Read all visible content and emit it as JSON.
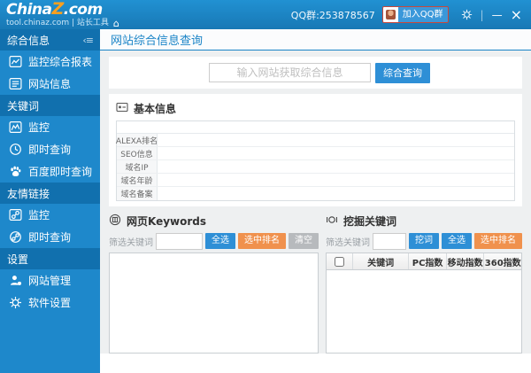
{
  "window": {
    "logo": {
      "china": "China",
      "z": "Z",
      "com": ".com"
    },
    "subtitle": "tool.chinaz.com | 站长工具",
    "home_icon": "⌂",
    "qq_group_label": "QQ群:253878567",
    "join_qq_label": "加入QQ群",
    "controls": {
      "separator": "|",
      "minimize": "—",
      "close": "×"
    }
  },
  "sidebar": {
    "collapse_icon": "‹≡",
    "sections": [
      {
        "label": "综合信息",
        "items": [
          {
            "label": "监控综合报表",
            "icon": "report-chart-icon"
          },
          {
            "label": "网站信息",
            "icon": "site-info-icon"
          }
        ]
      },
      {
        "label": "关键词",
        "items": [
          {
            "label": "监控",
            "icon": "keyword-monitor-icon"
          },
          {
            "label": "即时查询",
            "icon": "clock-icon"
          },
          {
            "label": "百度即时查询",
            "icon": "baidu-paw-icon"
          }
        ]
      },
      {
        "label": "友情链接",
        "items": [
          {
            "label": "监控",
            "icon": "link-monitor-icon"
          },
          {
            "label": "即时查询",
            "icon": "link-query-icon"
          }
        ]
      },
      {
        "label": "设置",
        "items": [
          {
            "label": "网站管理",
            "icon": "user-icon"
          },
          {
            "label": "软件设置",
            "icon": "gear-icon"
          }
        ]
      }
    ]
  },
  "main": {
    "page_title": "网站综合信息查询",
    "search": {
      "placeholder": "输入网站获取综合信息",
      "button_label": "综合查询"
    },
    "basic_info": {
      "title": "基本信息",
      "row_labels": [
        "ALEXA排名",
        "SEO信息",
        "域名IP",
        "域名年龄",
        "域名备案"
      ]
    },
    "webpage_keywords": {
      "title": "网页Keywords",
      "filter_label": "筛选关键词",
      "select_all_label": "全选",
      "selected_rank_label": "选中排名",
      "clear_label": "清空"
    },
    "mining_keywords": {
      "title": "挖掘关键词",
      "filter_label": "筛选关键词",
      "dig_label": "挖词",
      "select_all_label": "全选",
      "selected_rank_label": "选中排名",
      "table_headers": [
        "关键词",
        "PC指数",
        "移动指数",
        "360指数"
      ]
    }
  },
  "colors": {
    "topbar_blue": "#1e86c6",
    "sidebar_blue": "#1e88cb",
    "section_blue": "#1170ae",
    "accent_blue": "#1a84c7",
    "button_blue": "#2e8fd6",
    "button_orange": "#f0914d",
    "button_gray": "#b7babd",
    "logo_z_orange": "#ffa01e",
    "join_button_border": "#c9473a"
  }
}
